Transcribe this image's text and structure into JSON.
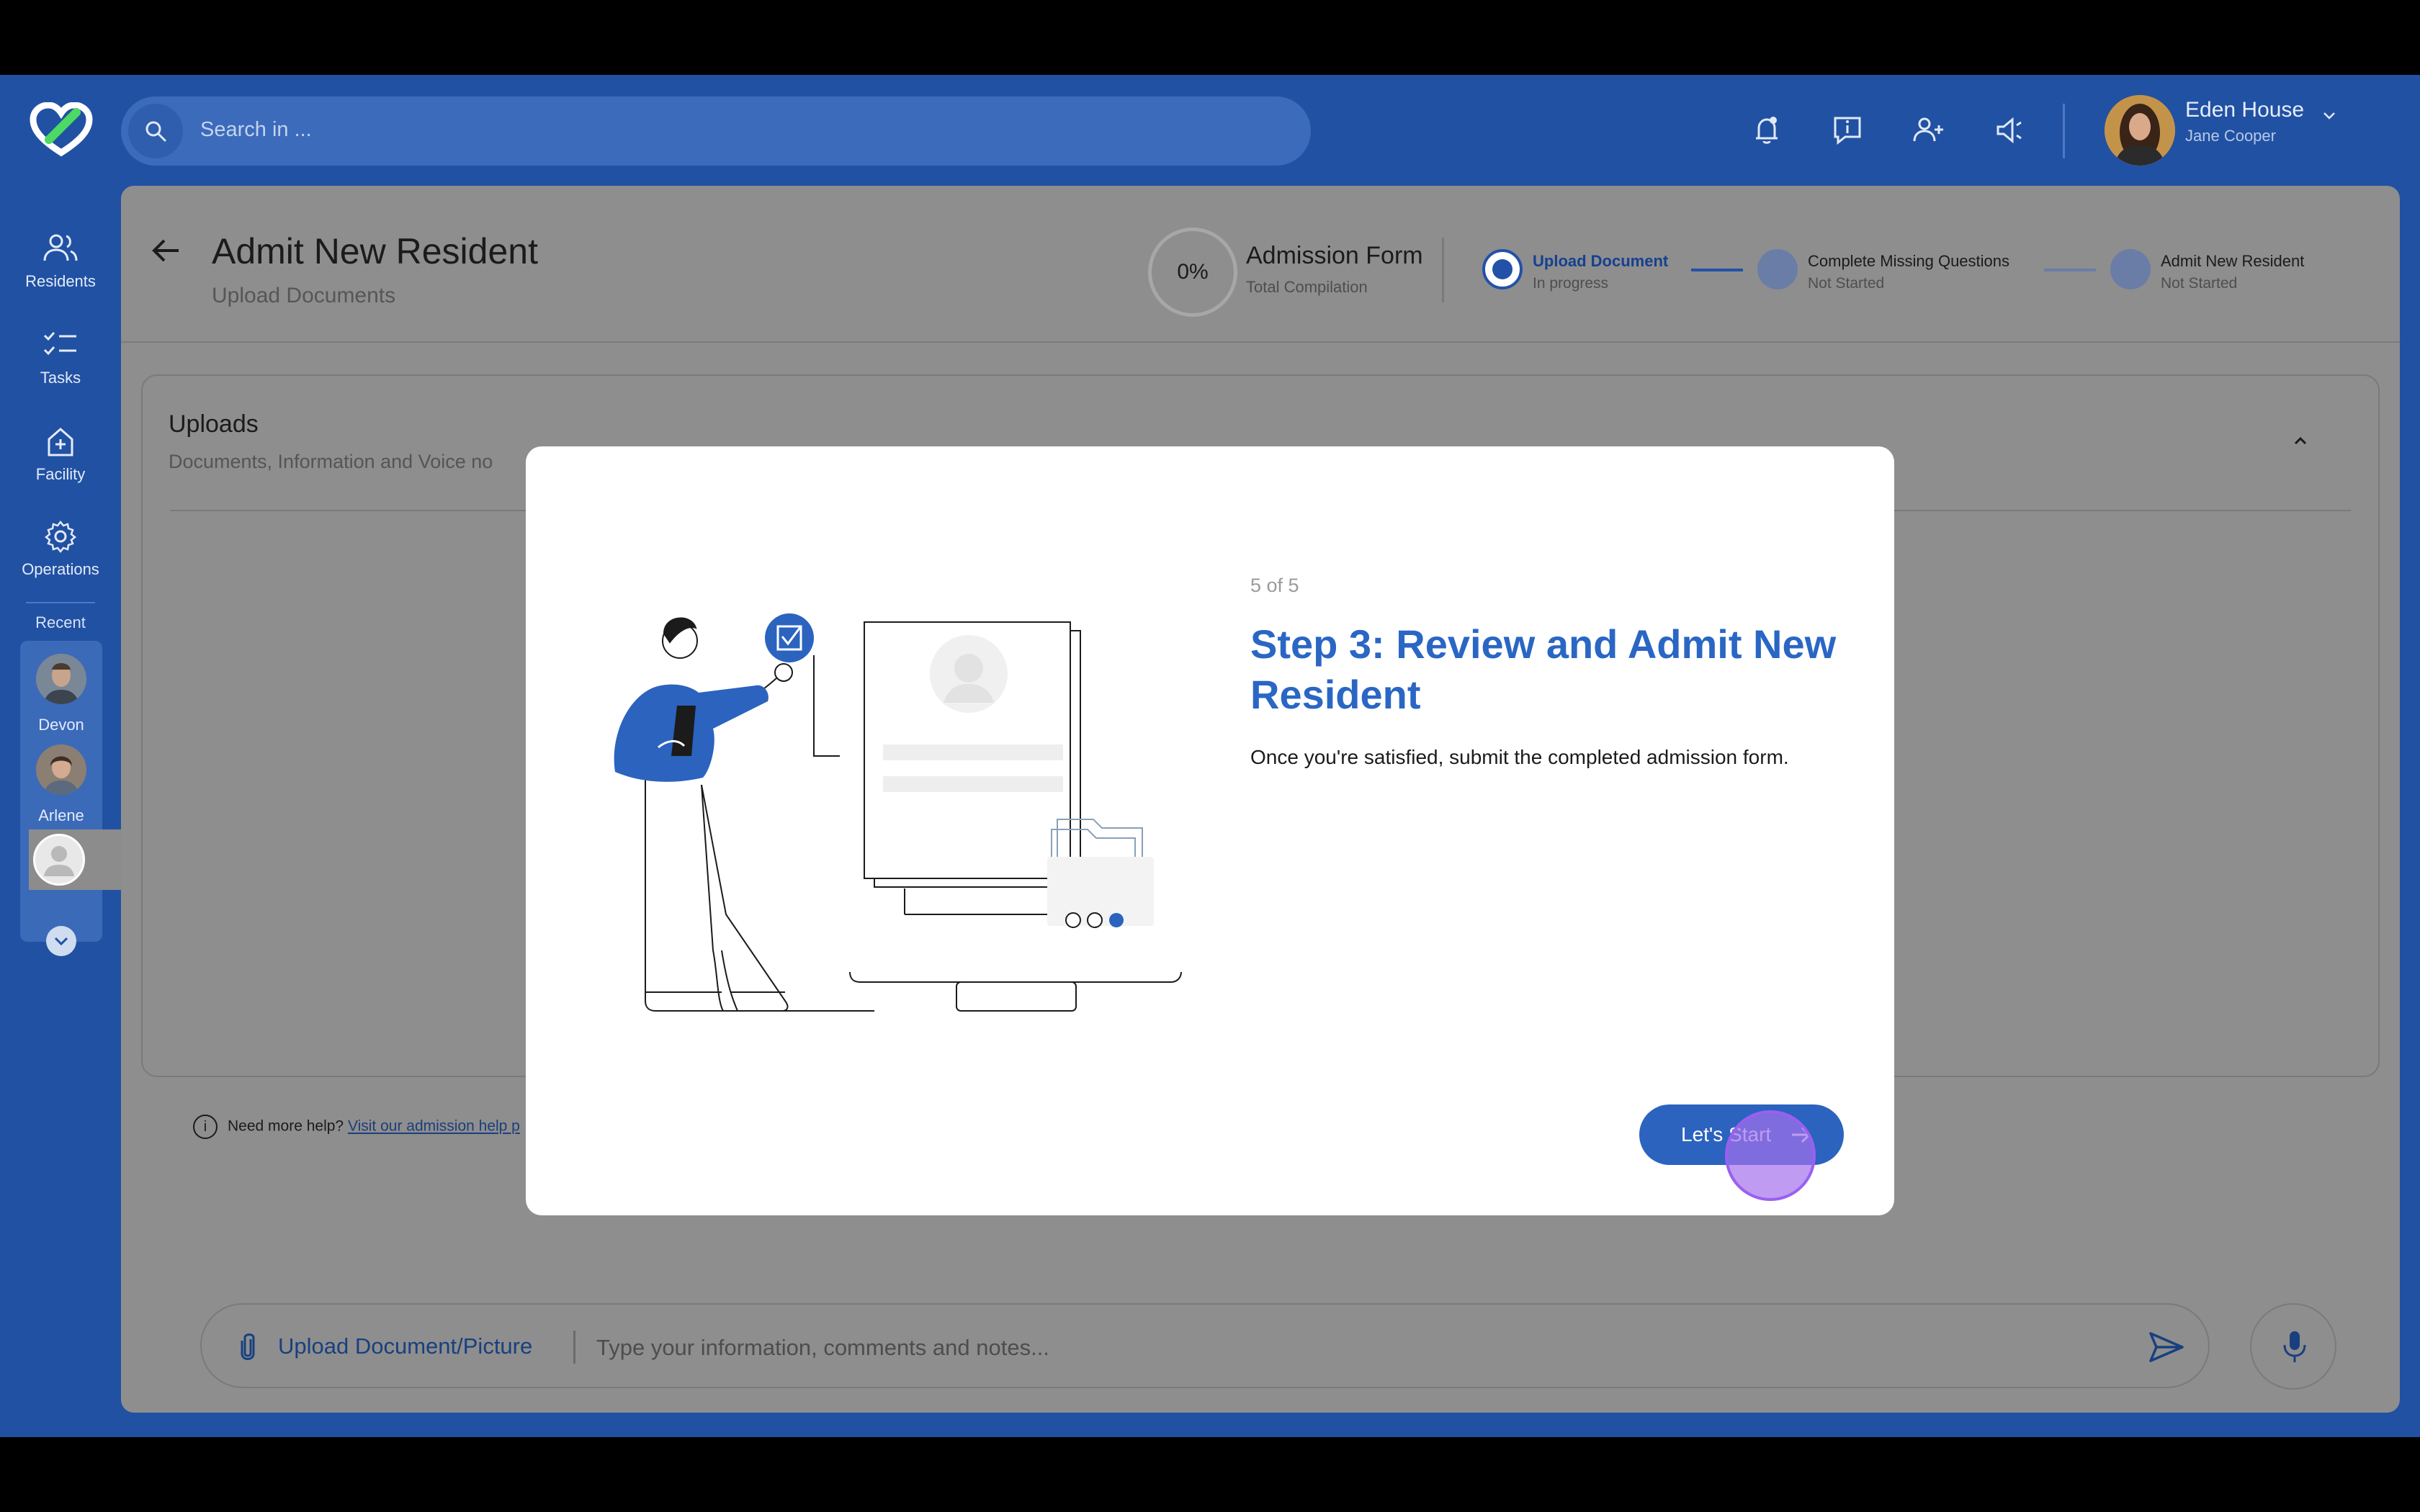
{
  "app": {
    "brand_colors": {
      "primary": "#2151a3",
      "accent": "#2b63bf",
      "active_step": "#2351a8"
    }
  },
  "search": {
    "placeholder": "Search in ..."
  },
  "top_icons": [
    "bell-icon",
    "info-message-icon",
    "add-user-icon",
    "announcement-icon"
  ],
  "user": {
    "name": "Eden House",
    "role": "Jane Cooper"
  },
  "sidebar": {
    "items": [
      {
        "label": "Residents",
        "icon": "residents-icon"
      },
      {
        "label": "Tasks",
        "icon": "tasks-icon"
      },
      {
        "label": "Facility",
        "icon": "facility-icon"
      },
      {
        "label": "Operations",
        "icon": "gear-icon"
      }
    ],
    "recent_label": "Recent",
    "recent": [
      {
        "name": "Devon"
      },
      {
        "name": "Arlene"
      }
    ]
  },
  "page": {
    "title": "Admit New Resident",
    "subtitle": "Upload Documents",
    "form": {
      "progress": "0%",
      "title": "Admission Form",
      "subtitle": "Total Compilation"
    },
    "steps": [
      {
        "label": "Upload Document",
        "status": "In progress"
      },
      {
        "label": "Complete Missing Questions",
        "status": "Not Started"
      },
      {
        "label": "Admit New Resident",
        "status": "Not Started"
      }
    ]
  },
  "uploads": {
    "title": "Uploads",
    "subtitle": "Documents, Information and Voice no"
  },
  "help": {
    "text": "Need more help?",
    "link": "Visit our admission help p"
  },
  "composer": {
    "upload_label": "Upload Document/Picture",
    "placeholder": "Type your information, comments and notes..."
  },
  "modal": {
    "counter": "5 of 5",
    "heading": "Step 3: Review and Admit New Resident",
    "description": "Once you're satisfied, submit the completed admission form.",
    "button": "Let's Start"
  }
}
